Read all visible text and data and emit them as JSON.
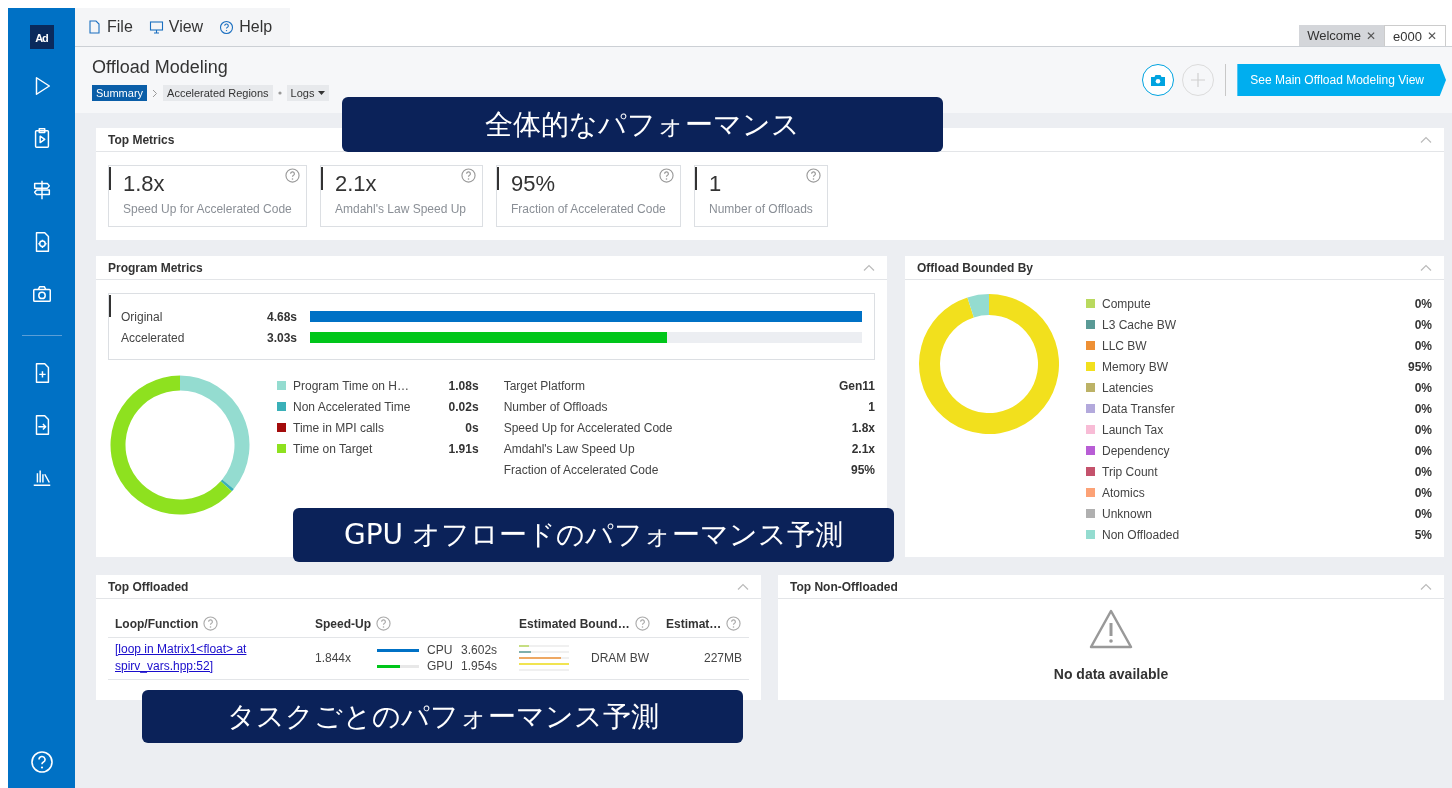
{
  "menu": [
    {
      "label": "File"
    },
    {
      "label": "View"
    },
    {
      "label": "Help"
    }
  ],
  "tabs": [
    {
      "label": "Welcome",
      "close": "✕",
      "selected": false
    },
    {
      "label": "e000",
      "close": "✕",
      "selected": true
    }
  ],
  "sidebar": {
    "logo": "Ad"
  },
  "header": {
    "title": "Offload Modeling",
    "breadcrumbs": [
      {
        "label": "Summary",
        "selected": true
      },
      {
        "label": "Accelerated Regions",
        "selected": false
      },
      {
        "label": "Logs",
        "selected": false
      }
    ],
    "main_button": "See Main Offload Modeling View"
  },
  "top_metrics": {
    "title": "Top Metrics",
    "cards": [
      {
        "value": "1.8x",
        "label": "Speed Up for Accelerated Code"
      },
      {
        "value": "2.1x",
        "label": "Amdahl's Law Speed Up"
      },
      {
        "value": "95%",
        "label": "Fraction of Accelerated Code"
      },
      {
        "value": "1",
        "label": "Number of Offloads"
      }
    ]
  },
  "program_metrics": {
    "title": "Program Metrics",
    "bars": [
      {
        "label": "Original",
        "value": "4.68s",
        "level": 1,
        "color": "#0071c5"
      },
      {
        "label": "Accelerated",
        "value": "3.03s",
        "level": 0.647,
        "color": "#00c61a"
      }
    ],
    "legend": [
      {
        "label": "Program Time on H…",
        "value": "1.08s",
        "color": "#94dcd0"
      },
      {
        "label": "Non Accelerated Time",
        "value": "0.02s",
        "color": "#3ab0b8"
      },
      {
        "label": "Time in MPI calls",
        "value": "0s",
        "color": "#a30c0c"
      },
      {
        "label": "Time on Target",
        "value": "1.91s",
        "color": "#8ee11f"
      }
    ],
    "chart_data": {
      "type": "donut",
      "values": [
        35.9,
        0.7,
        0,
        63.4
      ]
    },
    "details": [
      {
        "label": "Target Platform",
        "value": "Gen11"
      },
      {
        "label": "Number of Offloads",
        "value": "1"
      },
      {
        "label": "Speed Up for Accelerated Code",
        "value": "1.8x"
      },
      {
        "label": "Amdahl's Law Speed Up",
        "value": "2.1x"
      },
      {
        "label": "Fraction of Accelerated Code",
        "value": "95%"
      }
    ]
  },
  "offload_bounded_by": {
    "title": "Offload Bounded By",
    "legend": [
      {
        "label": "Compute",
        "value": "0%",
        "color": "#b9d95e"
      },
      {
        "label": "L3 Cache BW",
        "value": "0%",
        "color": "#5a9a96"
      },
      {
        "label": "LLC BW",
        "value": "0%",
        "color": "#ee9035"
      },
      {
        "label": "Memory BW",
        "value": "95%",
        "color": "#f2e01d"
      },
      {
        "label": "Latencies",
        "value": "0%",
        "color": "#bcb266"
      },
      {
        "label": "Data Transfer",
        "value": "0%",
        "color": "#b3a9dc"
      },
      {
        "label": "Launch Tax",
        "value": "0%",
        "color": "#f8bcd6"
      },
      {
        "label": "Dependency",
        "value": "0%",
        "color": "#b85dd5"
      },
      {
        "label": "Trip Count",
        "value": "0%",
        "color": "#c4526c"
      },
      {
        "label": "Atomics",
        "value": "0%",
        "color": "#fca276"
      },
      {
        "label": "Unknown",
        "value": "0%",
        "color": "#b0b0b0"
      },
      {
        "label": "Non Offloaded",
        "value": "5%",
        "color": "#94dcd0"
      }
    ],
    "chart_data": {
      "type": "donut",
      "values": [
        0,
        0,
        0,
        95,
        0,
        0,
        0,
        0,
        0,
        0,
        0,
        5
      ]
    }
  },
  "top_offloaded": {
    "title": "Top Offloaded",
    "columns": [
      {
        "label": "Loop/Function"
      },
      {
        "label": "Speed-Up"
      },
      {
        "label": "Estimated Bound…"
      },
      {
        "label": "Estimat…"
      }
    ],
    "rows": [
      {
        "loop": "[loop in Matrix1<float> at spirv_vars.hpp:52]",
        "speed_up": "1.844x",
        "times": [
          {
            "label": "CPU",
            "time": "3.602s",
            "level": 1,
            "color": "#0071c5"
          },
          {
            "label": "GPU",
            "time": "1.954s",
            "level": 0.54,
            "color": "#00c61a"
          }
        ],
        "bound": "DRAM BW",
        "memory": "227MB"
      }
    ]
  },
  "top_non_offloaded": {
    "title": "Top Non-Offloaded",
    "message": "No data available"
  },
  "callouts": [
    {
      "text": "全体的なパフォーマンス"
    },
    {
      "text": "GPU オフロードのパフォーマンス予測"
    },
    {
      "text": "タスクごとのパフォーマンス予測"
    }
  ]
}
